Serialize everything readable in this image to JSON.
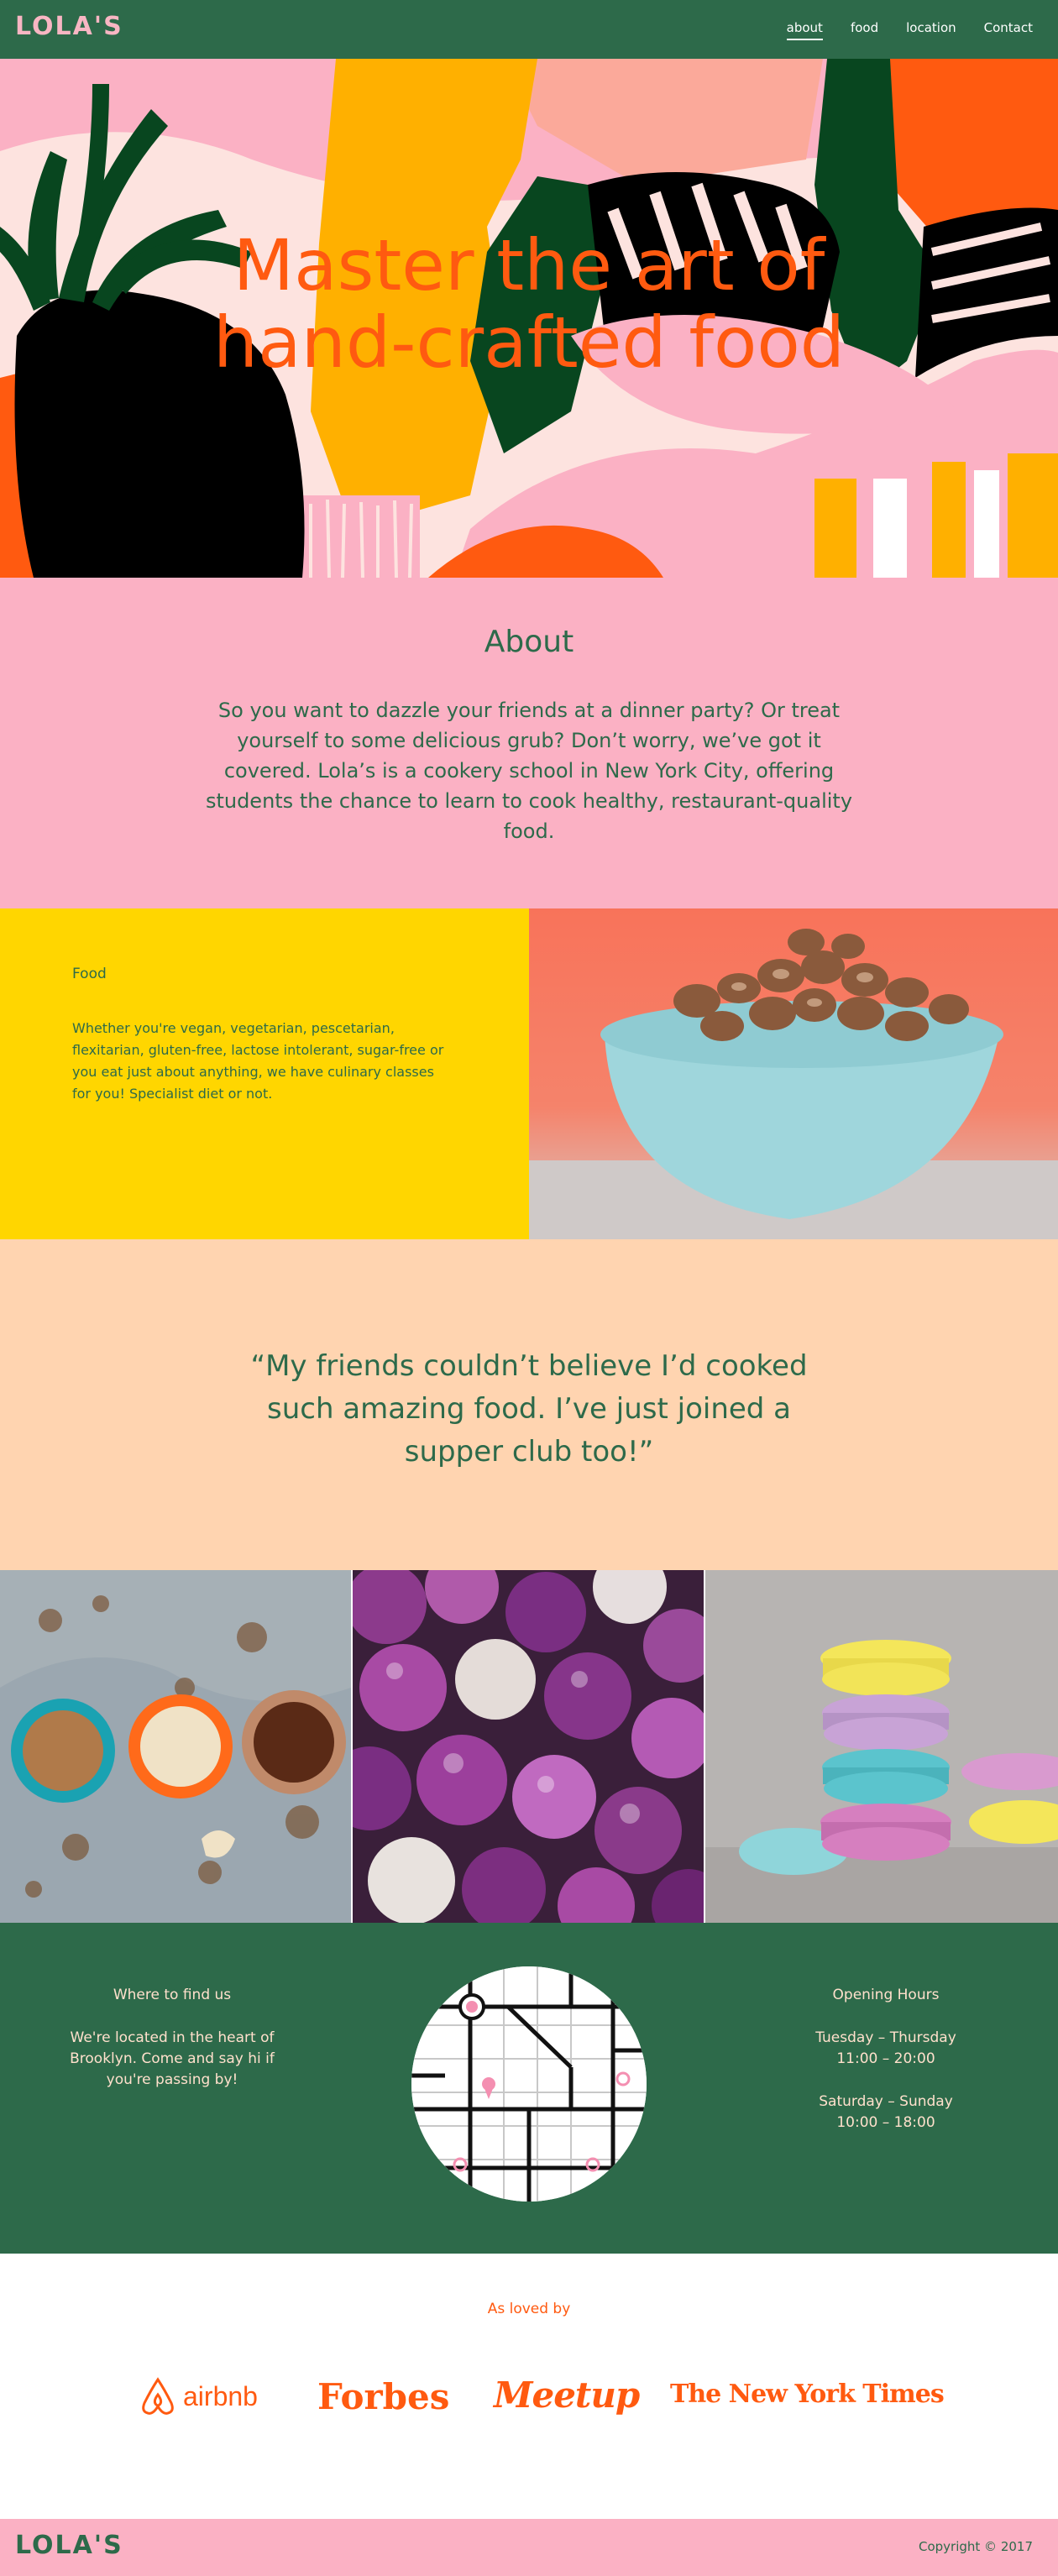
{
  "brand": {
    "logo_text": "LOLA'S"
  },
  "nav": {
    "links": [
      "about",
      "food",
      "location",
      "Contact"
    ],
    "active": "about"
  },
  "hero": {
    "title_line1": "Master the art of",
    "title_line2": "hand-crafted food"
  },
  "about": {
    "heading": "About",
    "body": "So you want to dazzle your friends at a dinner party? Or treat yourself to some delicious grub? Don’t worry, we’ve got it covered. Lola’s is a cookery school in New York City, offering students the chance to learn to cook healthy, restaurant-quality food."
  },
  "food": {
    "heading": "Food",
    "body": "Whether you're vegan, vegetarian, pescetarian, flexitarian, gluten-free, lactose intolerant, sugar-free or you eat just about anything, we have culinary classes for you! Specialist diet or not."
  },
  "quote": {
    "text": "“My friends couldn’t believe I’d cooked such amazing food. I’ve just joined a supper club too!”"
  },
  "location": {
    "heading": "Where to find us",
    "body": "We're located in the heart of Brooklyn. Come and say hi if you're passing by!"
  },
  "hours": {
    "heading": "Opening Hours",
    "weekday_label": "Tuesday – Thursday",
    "weekday_time": "11:00 – 20:00",
    "weekend_label": "Saturday – Sunday",
    "weekend_time": "10:00 – 18:00"
  },
  "loved": {
    "heading": "As loved by",
    "brands": [
      "airbnb",
      "Forbes",
      "Meetup",
      "The New York Times"
    ]
  },
  "footer": {
    "copyright": "Copyright © 2017"
  },
  "colors": {
    "green": "#2d6a4a",
    "pink": "#fbb1c4",
    "orange": "#ff5a10",
    "yellow": "#ffd600",
    "peach": "#ffd4b0"
  }
}
